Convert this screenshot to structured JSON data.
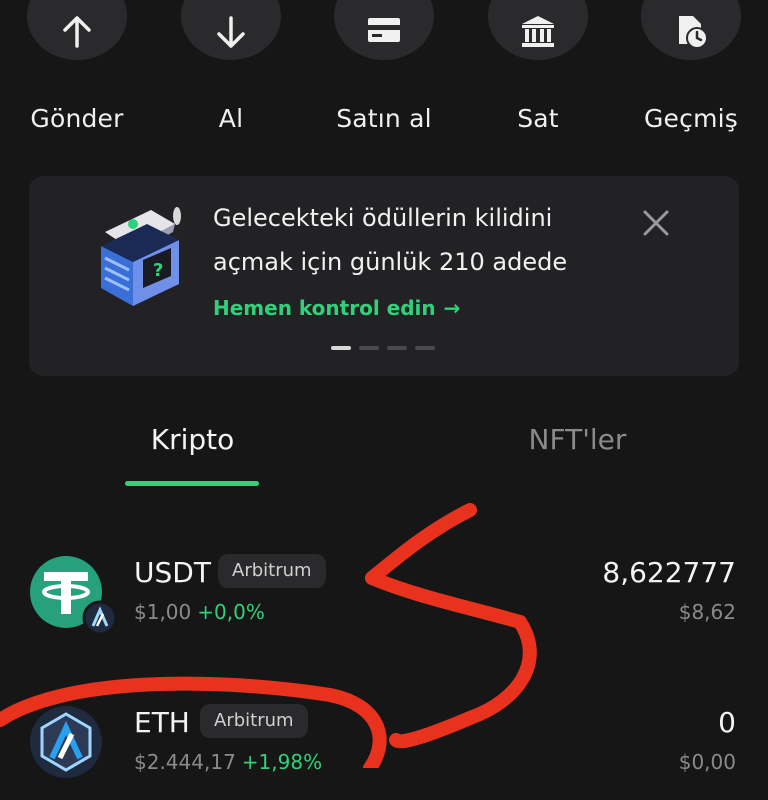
{
  "actions": [
    {
      "label": "Gönder",
      "icon": "arrow-up-icon"
    },
    {
      "label": "Al",
      "icon": "arrow-down-icon"
    },
    {
      "label": "Satın al",
      "icon": "card-icon"
    },
    {
      "label": "Sat",
      "icon": "bank-icon"
    },
    {
      "label": "Geçmiş",
      "icon": "history-icon"
    }
  ],
  "banner": {
    "line1": "Gelecekteki ödüllerin kilidini",
    "line2": "açmak için günlük 210 adede",
    "cta": "Hemen kontrol edin",
    "slide_count": 4,
    "active_slide": 1
  },
  "tabs": [
    {
      "label": "Kripto",
      "active": true
    },
    {
      "label": "NFT'ler",
      "active": false
    }
  ],
  "assets": [
    {
      "symbol": "USDT",
      "network": "Arbitrum",
      "price": "$1,00",
      "change": "+0,0%",
      "amount": "8,622777",
      "fiat": "$8,62",
      "icon": "tether-icon"
    },
    {
      "symbol": "ETH",
      "network": "Arbitrum",
      "price": "$2.444,17",
      "change": "+1,98%",
      "amount": "0",
      "fiat": "$0,00",
      "icon": "arbitrum-icon"
    }
  ],
  "colors": {
    "accent": "#2ed27a",
    "background": "#161616",
    "card": "#222224",
    "annotation": "#e8321e"
  }
}
